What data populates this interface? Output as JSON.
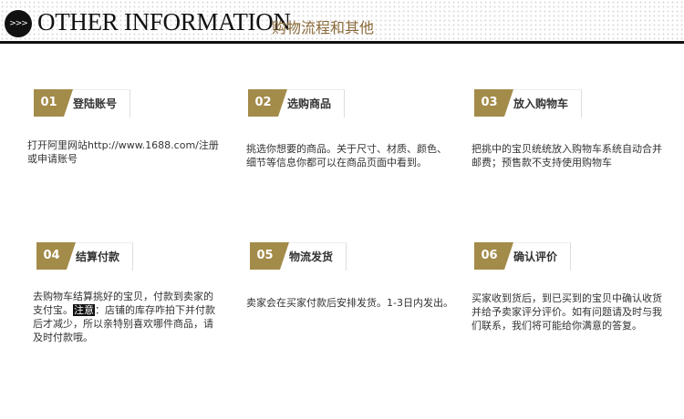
{
  "header": {
    "icon_text": ">>>",
    "title": "OTHER INFORMATION",
    "subtitle": "购物流程和其他"
  },
  "colors": {
    "badge": "#a38b4a",
    "header_line": "#111111",
    "subtitle": "#8a6a3a"
  },
  "steps": [
    {
      "num": "01",
      "label": "登陆账号",
      "desc": "打开阿里网站http://www.1688.com/注册或申请账号"
    },
    {
      "num": "02",
      "label": "选购商品",
      "desc": "挑选你想要的商品。关于尺寸、材质、颜色、细节等信息你都可以在商品页面中看到。"
    },
    {
      "num": "03",
      "label": "放入购物车",
      "desc": "把挑中的宝贝统统放入购物车系统自动合并邮费；预售款不支持使用购物车"
    },
    {
      "num": "04",
      "label": "结算付款",
      "desc_pre": "去购物车结算挑好的宝贝，付款到卖家的支付宝。",
      "notice": "注意",
      "desc_post": "：店铺的库存咋拍下并付款后才减少，所以亲特别喜欢哪件商品，请及时付款哦。"
    },
    {
      "num": "05",
      "label": "物流发货",
      "desc": "卖家会在买家付款后安排发货。1-3日内发出。"
    },
    {
      "num": "06",
      "label": "确认评价",
      "desc": "买家收到货后，到已买到的宝贝中确认收货并给予卖家评分评价。如有问题请及时与我们联系，我们将可能给你满意的答复。"
    }
  ]
}
